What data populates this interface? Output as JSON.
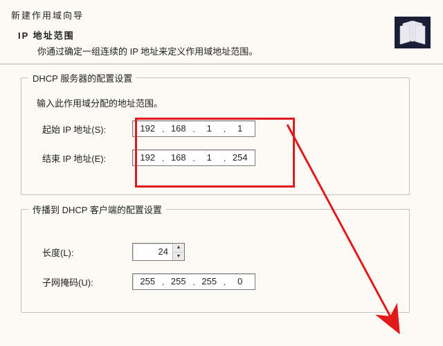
{
  "wizard": {
    "title": "新建作用域向导",
    "heading": "IP 地址范围",
    "description": "你通过确定一组连续的 IP 地址来定义作用域地址范围。"
  },
  "group1": {
    "legend": "DHCP 服务器的配置设置",
    "hint": "输入此作用域分配的地址范围。",
    "start_label": "起始 IP 地址(S):",
    "end_label": "结束 IP 地址(E):",
    "start_ip": {
      "a": "192",
      "b": "168",
      "c": "1",
      "d": "1"
    },
    "end_ip": {
      "a": "192",
      "b": "168",
      "c": "1",
      "d": "254"
    }
  },
  "group2": {
    "legend": "传播到 DHCP 客户端的配置设置",
    "length_label": "长度(L):",
    "length_value": "24",
    "mask_label": "子网掩码(U):",
    "mask": {
      "a": "255",
      "b": "255",
      "c": "255",
      "d": "0"
    }
  },
  "annotation": {
    "highlight_color": "#e21a1a"
  }
}
